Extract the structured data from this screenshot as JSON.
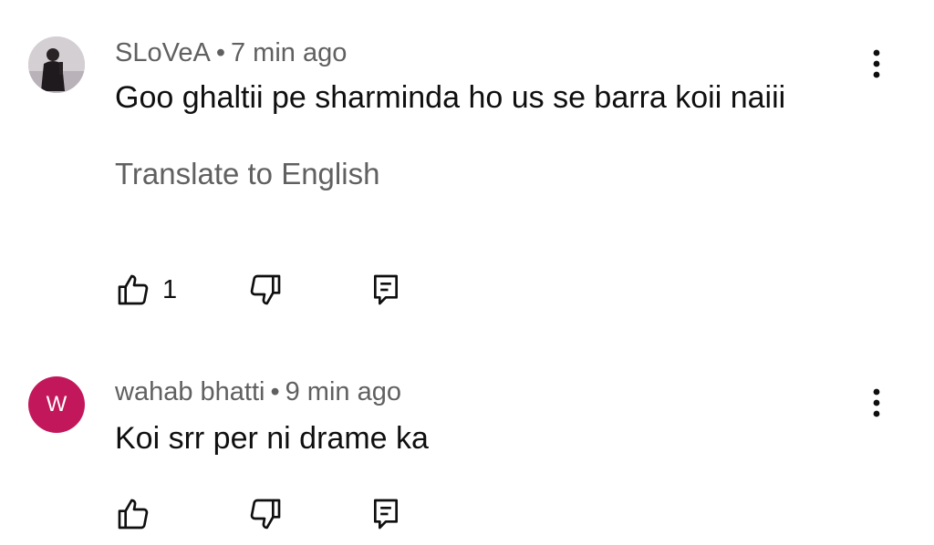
{
  "comments": [
    {
      "author": "SLoVeA",
      "separator": "•",
      "time": "7 min ago",
      "text": "Goo ghaltii pe sharminda ho us se barra koii naiii",
      "translate_label": "Translate to English",
      "like_count": "1",
      "avatar": {
        "type": "photo",
        "icon": "user-photo-avatar"
      }
    },
    {
      "author": "wahab bhatti",
      "separator": "•",
      "time": "9 min ago",
      "text": "Koi srr per ni drame ka",
      "like_count": "",
      "avatar": {
        "type": "letter",
        "letter": "W",
        "color": "#c2185b"
      }
    }
  ],
  "icons": {
    "like": "thumbs-up-icon",
    "dislike": "thumbs-down-icon",
    "reply": "reply-comment-icon",
    "more": "more-vertical-icon"
  }
}
